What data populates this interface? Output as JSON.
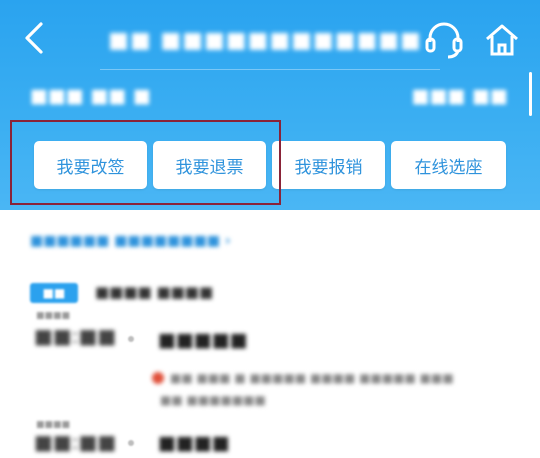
{
  "header": {
    "title_obscured": "■■ ■■■■■■■■■■■■",
    "subtitle_left_obscured": "■■■ ■■ ■",
    "subtitle_right_obscured": "■■■ ■■",
    "back_icon": "chevron-left-icon",
    "service_icon": "headset-icon",
    "home_icon": "home-icon",
    "background_color": "#2aa3ef"
  },
  "actions": [
    {
      "label": "我要改签"
    },
    {
      "label": "我要退票"
    },
    {
      "label": "我要报销"
    },
    {
      "label": "在线选座"
    }
  ],
  "info": {
    "links_obscured": "■■■■■■  ■■■■■■■■ ›",
    "tag_obscured": "■■",
    "tag_text_obscured": "■■■■ ■■■■",
    "stops": [
      {
        "date_obscured": "■■■■",
        "time_obscured": "■■:■■",
        "station_obscured": "■■■■■",
        "detail_line1_obscured": "■■ ■■■ ■ ■■■■■  ■■■■  ■■■■■  ■■■",
        "detail_line2_obscured": "■■  ■■■■■■■"
      },
      {
        "date_obscured": "■■■■",
        "time_obscured": "■■:■■",
        "station_obscured": "■■■■"
      }
    ]
  }
}
